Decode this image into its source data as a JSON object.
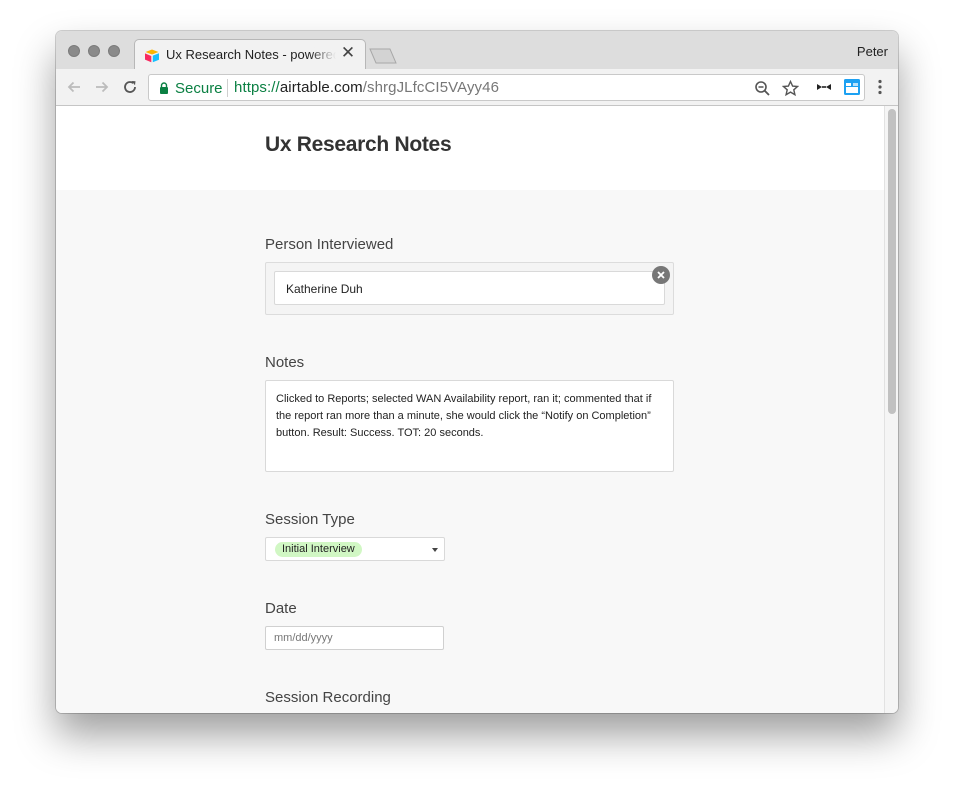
{
  "browser": {
    "tab_title": "Ux Research Notes - powered by Airtable",
    "tab_close": "✕",
    "profile_name": "Peter",
    "security_label": "Secure",
    "url_scheme": "https://",
    "url_host": "airtable.com",
    "url_path": "/shrgJLfcCI5VAyy46"
  },
  "form": {
    "title": "Ux Research Notes",
    "fields": {
      "person": {
        "label": "Person Interviewed",
        "value": "Katherine Duh"
      },
      "notes": {
        "label": "Notes",
        "value": "Clicked to Reports; selected WAN Availability report, ran it; commented that if the report ran more than a minute, she would click the “Notify on Completion” button. Result: Success. TOT: 20 seconds."
      },
      "session_type": {
        "label": "Session Type",
        "value": "Initial Interview",
        "pill_color": "#d1f7c4"
      },
      "date": {
        "label": "Date",
        "placeholder": "mm/dd/yyyy"
      },
      "recording": {
        "label": "Session Recording"
      }
    }
  },
  "colors": {
    "secure_green": "#0b8043",
    "form_background": "#f8f8f8",
    "header_background": "#ffffff"
  },
  "icons": {
    "back": "arrow-left-icon",
    "forward": "arrow-right-icon",
    "reload": "reload-icon",
    "lock": "lock-icon",
    "zoom": "zoom-out-icon",
    "bookmark": "star-icon",
    "extension_1": "extension-icon",
    "extension_2": "extension-icon",
    "menu": "kebab-menu-icon",
    "remove": "close-circle-icon",
    "dropdown": "caret-down-icon"
  }
}
